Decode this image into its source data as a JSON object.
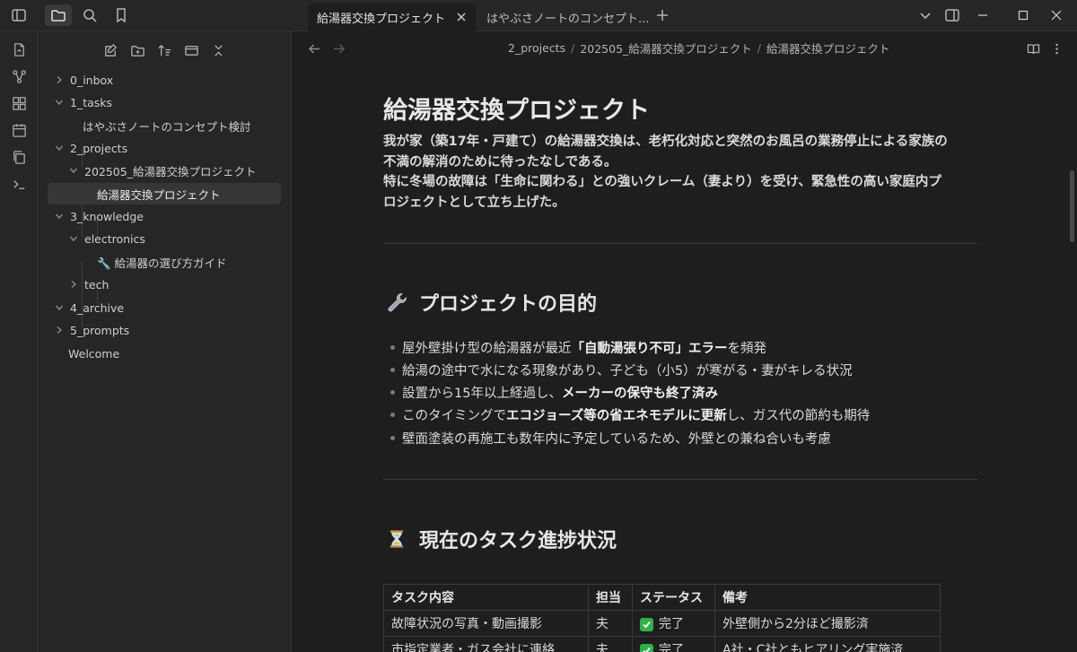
{
  "tabs": [
    {
      "label": "給湯器交換プロジェクト"
    },
    {
      "label": "はやぶさノートのコンセプト..."
    }
  ],
  "sidebar": {
    "tree": [
      {
        "label": "0_inbox"
      },
      {
        "label": "1_tasks"
      },
      {
        "label": "はやぶさノートのコンセプト検討"
      },
      {
        "label": "2_projects"
      },
      {
        "label": "202505_給湯器交換プロジェクト"
      },
      {
        "label": "給湯器交換プロジェクト"
      },
      {
        "label": "3_knowledge"
      },
      {
        "label": "electronics"
      },
      {
        "label": "🔧 給湯器の選び方ガイド"
      },
      {
        "label": "tech"
      },
      {
        "label": "4_archive"
      },
      {
        "label": "5_prompts"
      },
      {
        "label": "Welcome"
      }
    ]
  },
  "breadcrumb": [
    "2_projects",
    "202505_給湯器交換プロジェクト",
    "給湯器交換プロジェクト"
  ],
  "doc": {
    "title": "給湯器交換プロジェクト",
    "intro": [
      "我が家（築17年・戸建て）の給湯器交換は、老朽化対応と突然のお風呂の業務停止による家族の",
      "不満の解消のために待ったなしである。",
      "特に冬場の故障は「生命に関わる」との強いクレーム（妻より）を受け、緊急性の高い家庭内プ",
      "ロジェクトとして立ち上げた。"
    ],
    "section1": {
      "heading": "プロジェクトの目的",
      "bullets": [
        {
          "pre": "屋外壁掛け型の給湯器が最近 ",
          "bold": "「自動湯張り不可」エラー",
          "post": " を頻発"
        },
        {
          "pre": "給湯の途中で水になる現象があり、子ども（小5）が寒がる・妻がキレる状況",
          "bold": "",
          "post": ""
        },
        {
          "pre": "設置から15年以上経過し、",
          "bold": "メーカーの保守も終了済み",
          "post": ""
        },
        {
          "pre": "このタイミングで",
          "bold": "エコジョーズ等の省エネモデルに更新",
          "post": "し、ガス代の節約も期待"
        },
        {
          "pre": "壁面塗装の再施工も数年内に予定しているため、外壁との兼ね合いも考慮",
          "bold": "",
          "post": ""
        }
      ]
    },
    "section2": {
      "heading": "現在のタスク進捗状況",
      "table": {
        "headers": [
          "タスク内容",
          "担当",
          "ステータス",
          "備考"
        ],
        "rows": [
          [
            "故障状況の写真・動画撮影",
            "夫",
            "完了",
            "外壁側から2分ほど撮影済"
          ],
          [
            "市指定業者・ガス会社に連絡",
            "夫",
            "完了",
            "A社・C社ともヒアリング実施済"
          ]
        ]
      }
    }
  }
}
